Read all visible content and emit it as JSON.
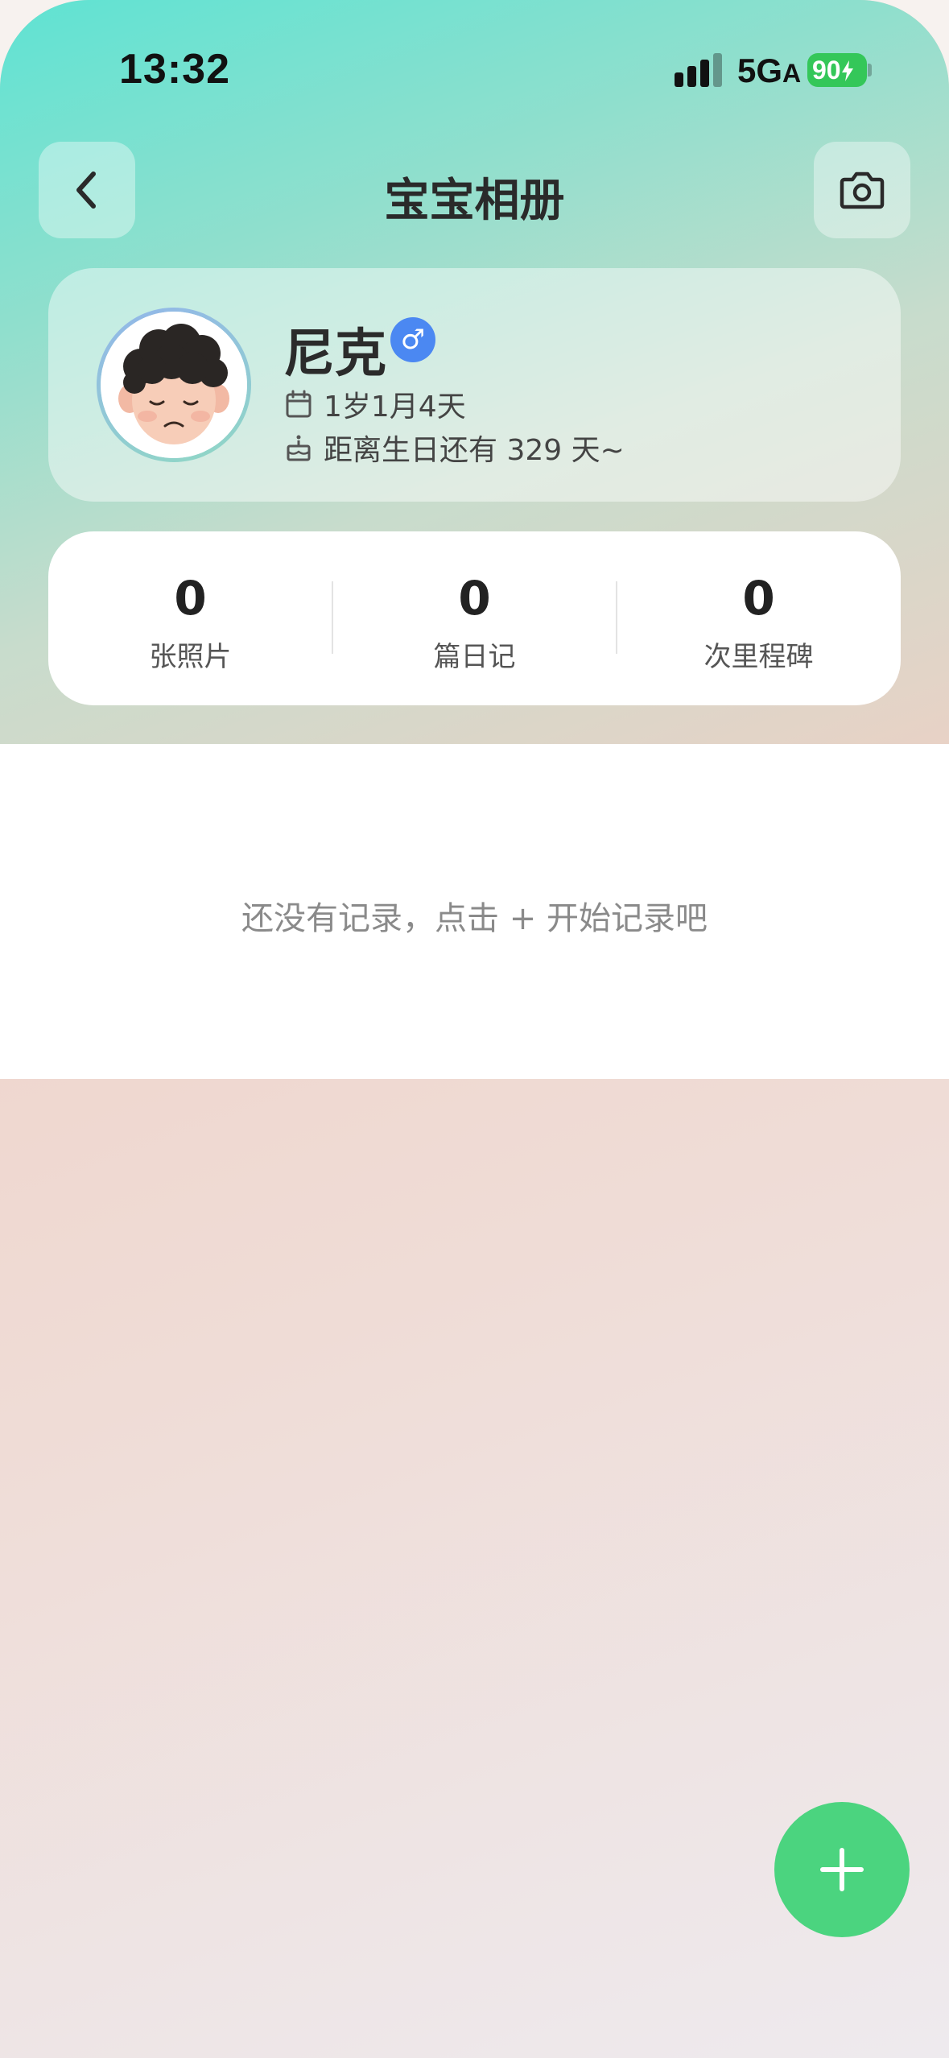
{
  "status_bar": {
    "time": "13:32",
    "network": "5G",
    "network_suffix": "A",
    "battery": "90"
  },
  "nav": {
    "title": "宝宝相册",
    "back_icon": "chevron-left-icon",
    "camera_icon": "camera-icon"
  },
  "profile": {
    "name": "尼克",
    "gender_symbol": "♂",
    "age": "1岁1月4天",
    "birthday_countdown": "距离生日还有 329 天~"
  },
  "stats": [
    {
      "value": "0",
      "label": "张照片"
    },
    {
      "value": "0",
      "label": "篇日记"
    },
    {
      "value": "0",
      "label": "次里程碑"
    }
  ],
  "empty_state": {
    "text": "还没有记录，点击 + 开始记录吧"
  },
  "colors": {
    "accent_green": "#4bd47f",
    "gender_blue": "#4b88f2",
    "battery_green": "#34c759"
  }
}
